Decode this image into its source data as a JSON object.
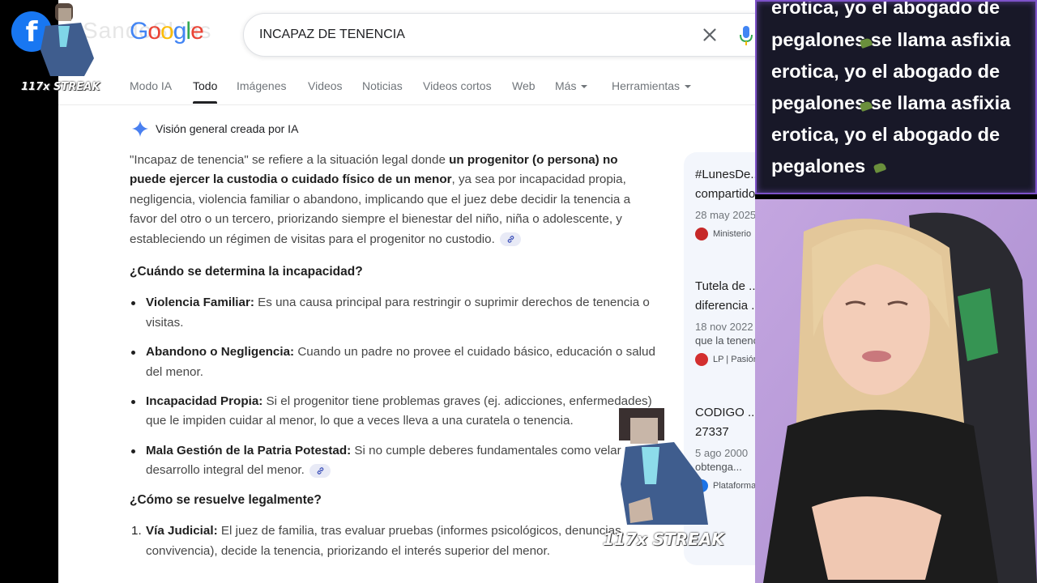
{
  "search": {
    "query": "INCAPAZ DE TENENCIA",
    "logo_letters": [
      {
        "ch": "G",
        "color": "#4285f4"
      },
      {
        "ch": "o",
        "color": "#ea4335"
      },
      {
        "ch": "o",
        "color": "#fbbc05"
      },
      {
        "ch": "g",
        "color": "#4285f4"
      },
      {
        "ch": "l",
        "color": "#34a853"
      },
      {
        "ch": "e",
        "color": "#ea4335"
      }
    ]
  },
  "tabs": [
    {
      "label": "Modo IA"
    },
    {
      "label": "Todo"
    },
    {
      "label": "Imágenes"
    },
    {
      "label": "Videos"
    },
    {
      "label": "Noticias"
    },
    {
      "label": "Videos cortos"
    },
    {
      "label": "Web"
    },
    {
      "label": "Más"
    },
    {
      "label": "Herramientas"
    }
  ],
  "ai_overview": {
    "header": "Visión general creada por IA",
    "intro_quote": "\"Incapaz de tenencia\" se refiere a la situación legal donde ",
    "intro_bold": "un progenitor (o persona) no puede ejercer la custodia o cuidado físico de un menor",
    "intro_rest": ", ya sea por incapacidad propia, negligencia, violencia familiar o abandono, implicando que el juez debe decidir la tenencia a favor del otro o un tercero, priorizando siempre el bienestar del niño, niña o adolescente, y estableciendo un régimen de visitas para el progenitor no custodio.",
    "heading1": "¿Cuándo se determina la incapacidad?",
    "bullets": [
      {
        "bold": "Violencia Familiar:",
        "text": " Es una causa principal para restringir o suprimir derechos de tenencia o visitas."
      },
      {
        "bold": "Abandono o Negligencia:",
        "text": " Cuando un padre no provee el cuidado básico, educación o salud del menor."
      },
      {
        "bold": "Incapacidad Propia:",
        "text": " Si el progenitor tiene problemas graves (ej. adicciones, enfermedades) que le impiden cuidar al menor, lo que a veces lleva a una curatela o tenencia."
      },
      {
        "bold": "Mala Gestión de la Patria Potestad:",
        "text": " Si no cumple deberes fundamentales como velar por el desarrollo integral del menor."
      }
    ],
    "heading2": "¿Cómo se resuelve legalmente?",
    "ordered": [
      {
        "num": "1.",
        "bold": "Vía Judicial:",
        "text": " El juez de familia, tras evaluar pruebas (informes psicológicos, denuncias, convivencia), decide la tenencia, priorizando el interés superior del menor."
      }
    ]
  },
  "side_cards": [
    {
      "title": "#LunesDe...",
      "title2": "compartido en contextos de ...",
      "date": "28 may 2025",
      "source": "Ministerio",
      "favicon_color": "#c62828"
    },
    {
      "title": "Tutela de ...",
      "title2": "diferencia ...",
      "date": "18 nov 2022",
      "snippet": "que la tenencia",
      "source": "LP | Pasión",
      "favicon_color": "#d32f2f"
    },
    {
      "title": "CODIGO ...",
      "title2": "27337",
      "date": "5 ago 2000",
      "snippet": "obtenga...",
      "source": "Plataforma"
    }
  ],
  "overlay": {
    "streak_label": "117x STREAK",
    "ghost_text": "SandoSkins"
  },
  "chat": {
    "lines": [
      "erotica, yo el abogado de",
      "pegalones  se llama asfixia",
      "erotica, yo el abogado de",
      "pegalones  se llama asfixia",
      "erotica, yo el abogado de",
      "pegalones "
    ]
  }
}
